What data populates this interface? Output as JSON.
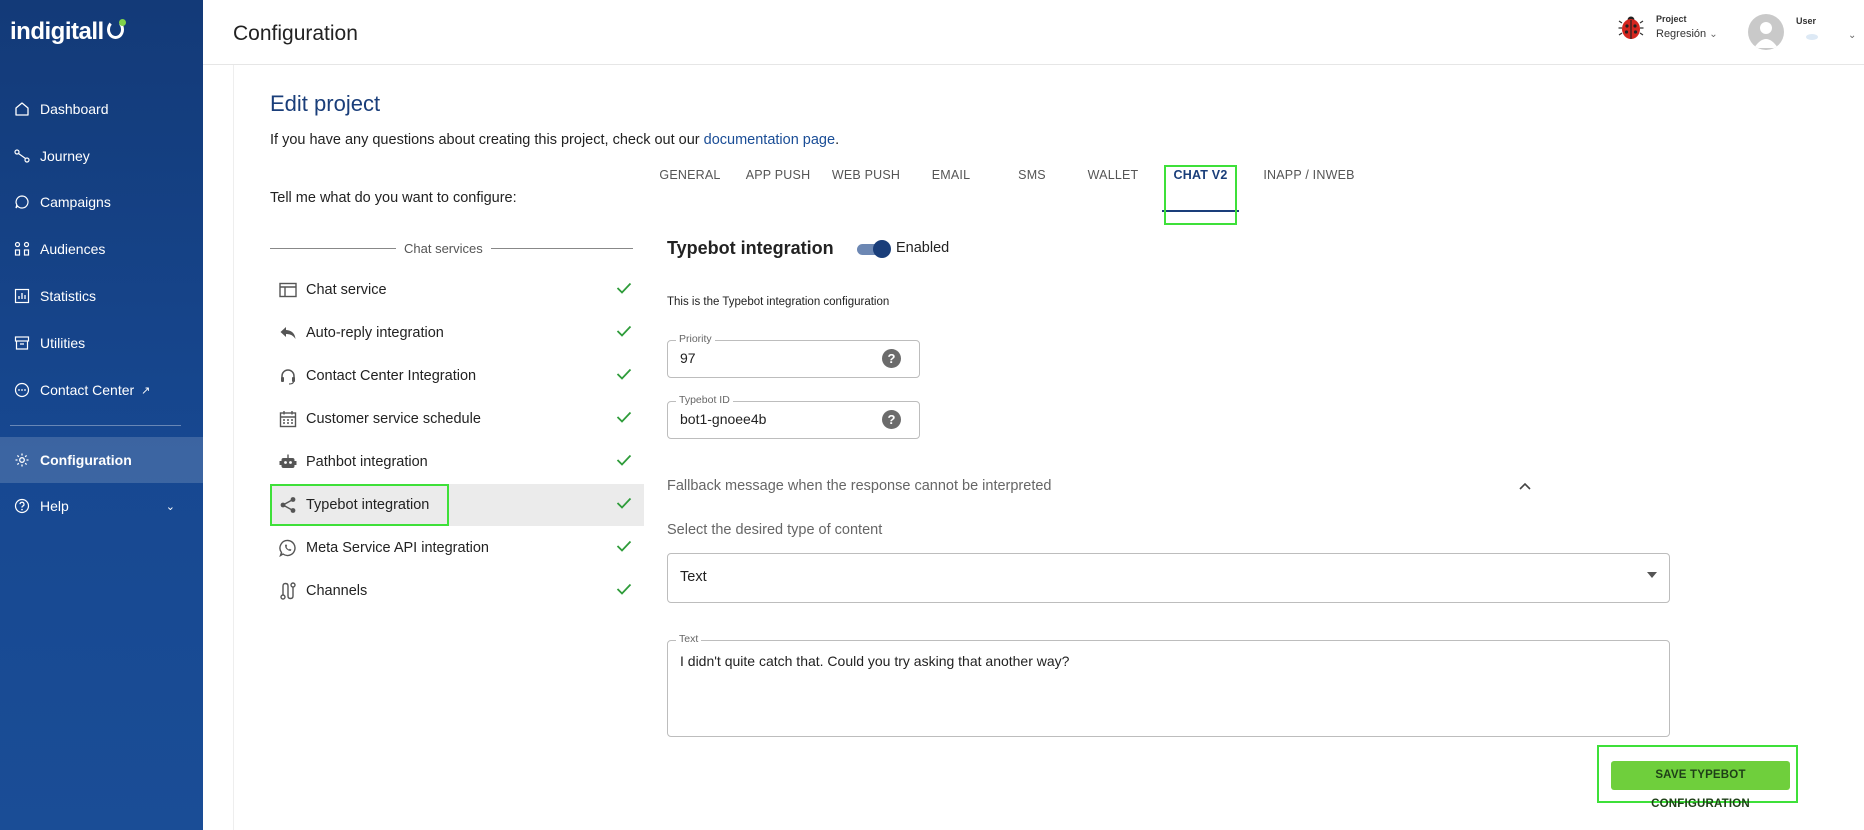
{
  "brand": {
    "name": "indigitall",
    "accent": "#7fd14a"
  },
  "sidebar": {
    "items": [
      {
        "label": "Dashboard",
        "icon": "home-icon"
      },
      {
        "label": "Journey",
        "icon": "journey-icon"
      },
      {
        "label": "Campaigns",
        "icon": "chat-bubble-icon"
      },
      {
        "label": "Audiences",
        "icon": "audiences-icon"
      },
      {
        "label": "Statistics",
        "icon": "bar-chart-icon"
      },
      {
        "label": "Utilities",
        "icon": "archive-icon"
      },
      {
        "label": "Contact Center",
        "icon": "chat-dots-icon",
        "external_icon": "↗"
      },
      {
        "label": "Configuration",
        "icon": "gear-icon"
      },
      {
        "label": "Help",
        "icon": "question-circle-icon"
      }
    ]
  },
  "header": {
    "title": "Configuration",
    "project_label": "Project",
    "project_value": "Regresión",
    "user_label": "User"
  },
  "main": {
    "heading": "Edit project",
    "intro_text": "If you have any questions about creating this project, check out our",
    "intro_link": "documentation page",
    "intro_end": ".",
    "prompt": "Tell me what do you want to configure:",
    "section_label": "Chat services",
    "services": [
      {
        "label": "Chat service",
        "icon": "browser-window-icon",
        "configured": true
      },
      {
        "label": "Auto-reply integration",
        "icon": "reply-icon",
        "configured": true
      },
      {
        "label": "Contact Center Integration",
        "icon": "headset-icon",
        "configured": true
      },
      {
        "label": "Customer service schedule",
        "icon": "calendar-icon",
        "configured": true
      },
      {
        "label": "Pathbot integration",
        "icon": "robot-icon",
        "configured": true
      },
      {
        "label": "Typebot integration",
        "icon": "share-icon",
        "configured": true,
        "selected": true
      },
      {
        "label": "Meta Service API integration",
        "icon": "whatsapp-icon",
        "configured": true
      },
      {
        "label": "Channels",
        "icon": "route-icon",
        "configured": true
      }
    ],
    "tabs": [
      {
        "label": "GENERAL"
      },
      {
        "label": "APP PUSH"
      },
      {
        "label": "WEB PUSH"
      },
      {
        "label": "EMAIL"
      },
      {
        "label": "SMS"
      },
      {
        "label": "WALLET"
      },
      {
        "label": "CHAT V2",
        "active": true
      },
      {
        "label": "INAPP / INWEB"
      }
    ]
  },
  "typebot": {
    "title": "Typebot integration",
    "toggle_label": "Enabled",
    "enabled": true,
    "description": "This is the Typebot integration configuration",
    "priority_label": "Priority",
    "priority_value": "97",
    "typebot_id_label": "Typebot ID",
    "typebot_id_value": "bot1-gnoee4b",
    "fallback_title": "Fallback message when the response cannot be interpreted",
    "content_type_label": "Select the desired type of content",
    "content_type_value": "Text",
    "text_label": "Text",
    "text_value": "I didn't quite catch that. Could you try asking that another way?",
    "save_label": "SAVE TYPEBOT CONFIGURATION"
  },
  "colors": {
    "primary": "#1a3e7a",
    "sidebar": "#174891",
    "save": "#6fcf3c",
    "check": "#2e9c3a",
    "highlight": "#3ee039"
  }
}
